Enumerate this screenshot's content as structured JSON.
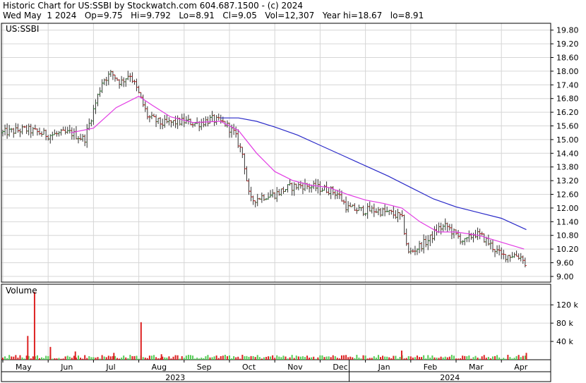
{
  "header": {
    "line1": "Historic Chart for US:SSBI by Stockwatch.com 604.687.1500 - (c) 2024",
    "line2": "Wed May  1 2024   Op=9.75   Hi=9.792   Lo=8.91   Cl=9.05   Vol=12,307   Year hi=18.67   lo=8.91"
  },
  "colors": {
    "up_bar": "#2e7d32",
    "down_bar": "#b71c1c",
    "ma_short": "#e23be3",
    "ma_long": "#2a2ac8",
    "grid": "#d6d6d6",
    "volume_up": "#55cc55",
    "volume_down": "#dd2222"
  },
  "chart_data": {
    "type": "line",
    "symbol_label": "US:SSBI",
    "price_axis": {
      "ticks": [
        "19.80",
        "19.20",
        "18.60",
        "18.00",
        "17.40",
        "16.80",
        "16.20",
        "15.60",
        "15.00",
        "14.40",
        "13.80",
        "13.20",
        "12.60",
        "12.00",
        "11.40",
        "10.80",
        "10.20",
        "9.60",
        "9.00"
      ],
      "ylim": [
        8.75,
        20.1
      ]
    },
    "volume_panel": {
      "label": "Volume",
      "ticks": [
        "120 k",
        "80 k",
        "40 k"
      ],
      "ylim": [
        0,
        165000
      ]
    },
    "x_months": [
      "May",
      "Jun",
      "Jul",
      "Aug",
      "Sep",
      "Oct",
      "Nov",
      "Dec",
      "Jan",
      "Feb",
      "Mar",
      "Apr"
    ],
    "x_years": [
      "2023",
      "2024"
    ],
    "price_series": [
      {
        "m": 0.0,
        "v": 15.3
      },
      {
        "m": 0.5,
        "v": 15.45
      },
      {
        "m": 1.0,
        "v": 15.2
      },
      {
        "m": 1.5,
        "v": 15.3
      },
      {
        "m": 1.8,
        "v": 15.0
      },
      {
        "m": 2.0,
        "v": 16.3
      },
      {
        "m": 2.2,
        "v": 17.6
      },
      {
        "m": 2.4,
        "v": 17.9
      },
      {
        "m": 2.6,
        "v": 17.5
      },
      {
        "m": 2.8,
        "v": 17.9
      },
      {
        "m": 3.0,
        "v": 17.0
      },
      {
        "m": 3.2,
        "v": 16.0
      },
      {
        "m": 3.5,
        "v": 15.7
      },
      {
        "m": 4.0,
        "v": 15.8
      },
      {
        "m": 4.3,
        "v": 15.7
      },
      {
        "m": 4.6,
        "v": 15.9
      },
      {
        "m": 4.9,
        "v": 15.7
      },
      {
        "m": 5.1,
        "v": 15.3
      },
      {
        "m": 5.3,
        "v": 14.3
      },
      {
        "m": 5.45,
        "v": 12.3
      },
      {
        "m": 5.7,
        "v": 12.5
      },
      {
        "m": 6.0,
        "v": 12.6
      },
      {
        "m": 6.3,
        "v": 12.9
      },
      {
        "m": 6.6,
        "v": 13.0
      },
      {
        "m": 6.9,
        "v": 12.9
      },
      {
        "m": 7.2,
        "v": 12.8
      },
      {
        "m": 7.4,
        "v": 12.6
      },
      {
        "m": 7.6,
        "v": 12.0
      },
      {
        "m": 7.9,
        "v": 11.9
      },
      {
        "m": 8.2,
        "v": 11.9
      },
      {
        "m": 8.5,
        "v": 11.8
      },
      {
        "m": 8.8,
        "v": 11.6
      },
      {
        "m": 8.95,
        "v": 10.0
      },
      {
        "m": 9.1,
        "v": 10.2
      },
      {
        "m": 9.4,
        "v": 10.6
      },
      {
        "m": 9.6,
        "v": 11.1
      },
      {
        "m": 9.8,
        "v": 11.2
      },
      {
        "m": 10.0,
        "v": 10.8
      },
      {
        "m": 10.2,
        "v": 10.5
      },
      {
        "m": 10.4,
        "v": 10.9
      },
      {
        "m": 10.6,
        "v": 10.7
      },
      {
        "m": 10.8,
        "v": 10.3
      },
      {
        "m": 11.0,
        "v": 9.9
      },
      {
        "m": 11.3,
        "v": 9.95
      },
      {
        "m": 11.5,
        "v": 9.8
      },
      {
        "m": 11.55,
        "v": 9.05
      }
    ],
    "ma_short": [
      {
        "m": 1.5,
        "v": 15.3
      },
      {
        "m": 2.0,
        "v": 15.5
      },
      {
        "m": 2.5,
        "v": 16.4
      },
      {
        "m": 3.0,
        "v": 16.9
      },
      {
        "m": 3.3,
        "v": 16.5
      },
      {
        "m": 3.7,
        "v": 16.0
      },
      {
        "m": 4.2,
        "v": 15.75
      },
      {
        "m": 4.8,
        "v": 15.8
      },
      {
        "m": 5.2,
        "v": 15.4
      },
      {
        "m": 5.6,
        "v": 14.4
      },
      {
        "m": 6.0,
        "v": 13.6
      },
      {
        "m": 6.4,
        "v": 13.2
      },
      {
        "m": 6.8,
        "v": 13.0
      },
      {
        "m": 7.2,
        "v": 12.9
      },
      {
        "m": 7.6,
        "v": 12.6
      },
      {
        "m": 8.0,
        "v": 12.35
      },
      {
        "m": 8.4,
        "v": 12.2
      },
      {
        "m": 8.8,
        "v": 12.0
      },
      {
        "m": 9.2,
        "v": 11.4
      },
      {
        "m": 9.6,
        "v": 10.95
      },
      {
        "m": 10.0,
        "v": 10.95
      },
      {
        "m": 10.5,
        "v": 10.8
      },
      {
        "m": 11.0,
        "v": 10.5
      },
      {
        "m": 11.5,
        "v": 10.2
      }
    ],
    "ma_long": [
      {
        "m": 4.8,
        "v": 15.95
      },
      {
        "m": 5.2,
        "v": 15.95
      },
      {
        "m": 5.6,
        "v": 15.8
      },
      {
        "m": 6.0,
        "v": 15.55
      },
      {
        "m": 6.5,
        "v": 15.2
      },
      {
        "m": 7.0,
        "v": 14.75
      },
      {
        "m": 7.5,
        "v": 14.3
      },
      {
        "m": 8.0,
        "v": 13.85
      },
      {
        "m": 8.5,
        "v": 13.4
      },
      {
        "m": 9.0,
        "v": 12.9
      },
      {
        "m": 9.5,
        "v": 12.4
      },
      {
        "m": 10.0,
        "v": 12.05
      },
      {
        "m": 10.5,
        "v": 11.8
      },
      {
        "m": 11.0,
        "v": 11.55
      },
      {
        "m": 11.55,
        "v": 11.05
      }
    ],
    "volume_spikes": [
      {
        "m": 0.55,
        "v": 52000
      },
      {
        "m": 0.7,
        "v": 148000
      },
      {
        "m": 1.05,
        "v": 28000
      },
      {
        "m": 3.05,
        "v": 82000
      },
      {
        "m": 1.6,
        "v": 18000
      },
      {
        "m": 2.45,
        "v": 15000
      },
      {
        "m": 3.5,
        "v": 12000
      },
      {
        "m": 8.8,
        "v": 20000
      },
      {
        "m": 11.55,
        "v": 15000
      }
    ]
  }
}
